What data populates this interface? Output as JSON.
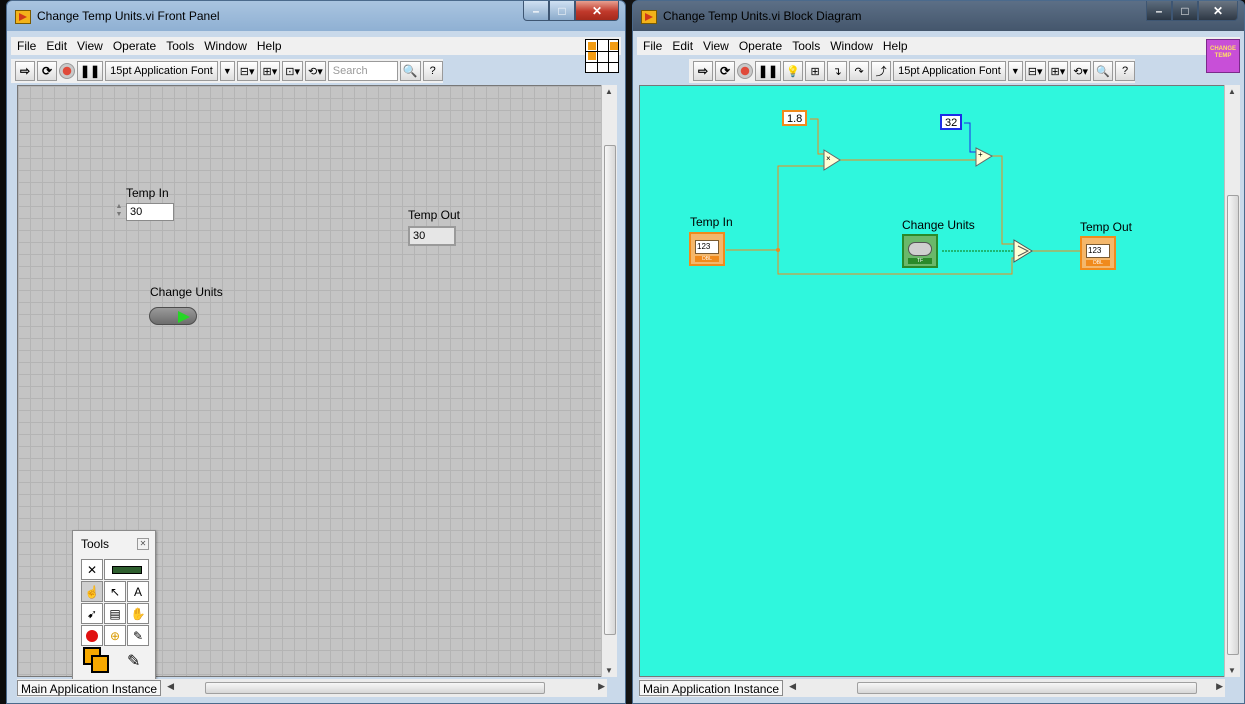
{
  "front_panel_window": {
    "title": "Change Temp Units.vi Front Panel",
    "menu": [
      "File",
      "Edit",
      "View",
      "Operate",
      "Tools",
      "Window",
      "Help"
    ],
    "toolbar": {
      "font": "15pt Application Font",
      "search_placeholder": "Search"
    },
    "controls": {
      "temp_in": {
        "label": "Temp In",
        "value": "30"
      },
      "temp_out": {
        "label": "Temp Out",
        "value": "30"
      },
      "change_units": {
        "label": "Change Units"
      }
    },
    "tools_palette": {
      "title": "Tools"
    },
    "status": "Main Application Instance"
  },
  "block_diagram_window": {
    "title": "Change Temp Units.vi Block Diagram",
    "menu": [
      "File",
      "Edit",
      "View",
      "Operate",
      "Tools",
      "Window",
      "Help"
    ],
    "toolbar": {
      "font": "15pt Application Font"
    },
    "vi_icon_text": "CHANGE TEMP",
    "nodes": {
      "const_multiplier": "1.8",
      "const_offset": "32",
      "temp_in": {
        "label": "Temp In",
        "display": "123",
        "type": "DBL"
      },
      "change_units": {
        "label": "Change Units",
        "type": "TF"
      },
      "temp_out": {
        "label": "Temp Out",
        "display": "123",
        "type": "DBL"
      },
      "multiply_symbol": "×",
      "add_symbol": "+"
    },
    "background_color": "#2ff7dd",
    "status": "Main Application Instance"
  }
}
